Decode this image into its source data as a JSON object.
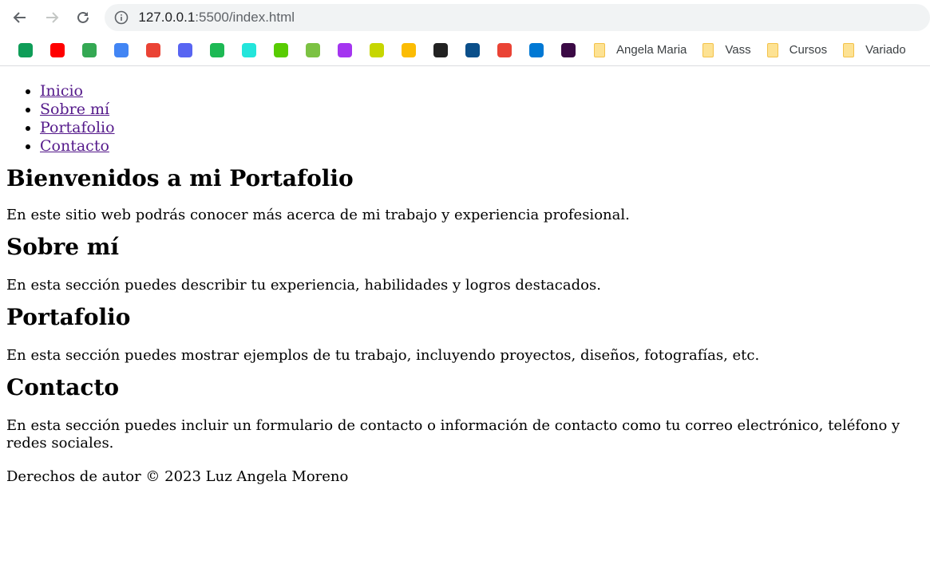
{
  "browser": {
    "url_host": "127.0.0.1",
    "url_path": ":5500/index.html",
    "bookmark_folders": [
      "Angela Maria",
      "Vass",
      "Cursos",
      "Variado"
    ],
    "bookmark_icons": [
      {
        "name": "google-sheets-icon",
        "color": "#0f9d58"
      },
      {
        "name": "youtube-icon",
        "color": "#ff0000"
      },
      {
        "name": "google-maps-icon",
        "color": "#34a853"
      },
      {
        "name": "google-translate-icon",
        "color": "#4285f4"
      },
      {
        "name": "gmail-icon",
        "color": "#ea4335"
      },
      {
        "name": "discord-icon",
        "color": "#5865f2"
      },
      {
        "name": "terminal-icon",
        "color": "#1db954"
      },
      {
        "name": "olx-icon",
        "color": "#23e5db"
      },
      {
        "name": "duolingo-icon",
        "color": "#58cc02"
      },
      {
        "name": "diamond-icon",
        "color": "#7cc243"
      },
      {
        "name": "udemy-icon",
        "color": "#a435f0"
      },
      {
        "name": "runner-icon",
        "color": "#c6d600"
      },
      {
        "name": "google-drive-icon",
        "color": "#fbbc04"
      },
      {
        "name": "sp-icon",
        "color": "#222222"
      },
      {
        "name": "triangle-app-icon",
        "color": "#0b4f8a"
      },
      {
        "name": "google-one-icon",
        "color": "#ea4335"
      },
      {
        "name": "outlook-square-icon",
        "color": "#0078d4"
      },
      {
        "name": "m-app-icon",
        "color": "#3b0a45"
      }
    ]
  },
  "nav": {
    "items": [
      "Inicio",
      "Sobre mí",
      "Portafolio",
      "Contacto"
    ]
  },
  "hero": {
    "title": "Bienvenidos a mi Portafolio",
    "text": "En este sitio web podrás conocer más acerca de mi trabajo y experiencia profesional."
  },
  "about": {
    "title": "Sobre mí",
    "text": "En esta sección puedes describir tu experiencia, habilidades y logros destacados."
  },
  "portfolio": {
    "title": "Portafolio",
    "text": "En esta sección puedes mostrar ejemplos de tu trabajo, incluyendo proyectos, diseños, fotografías, etc."
  },
  "contact": {
    "title": "Contacto",
    "text": "En esta sección puedes incluir un formulario de contacto o información de contacto como tu correo electrónico, teléfono y redes sociales."
  },
  "footer": {
    "text": "Derechos de autor © 2023 Luz Angela Moreno"
  }
}
